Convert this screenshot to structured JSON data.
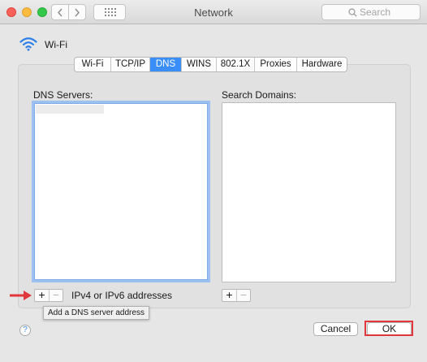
{
  "window": {
    "title": "Network",
    "search_placeholder": "Search"
  },
  "interface": {
    "name": "Wi-Fi"
  },
  "tabs": [
    {
      "label": "Wi-Fi"
    },
    {
      "label": "TCP/IP"
    },
    {
      "label": "DNS",
      "active": true
    },
    {
      "label": "WINS"
    },
    {
      "label": "802.1X"
    },
    {
      "label": "Proxies"
    },
    {
      "label": "Hardware"
    }
  ],
  "dns": {
    "servers_label": "DNS Servers:",
    "domains_label": "Search Domains:",
    "add_symbol": "+",
    "remove_symbol": "−",
    "hint": "IPv4 or IPv6 addresses",
    "tooltip": "Add a DNS server address"
  },
  "footer": {
    "help_symbol": "?",
    "cancel_label": "Cancel",
    "ok_label": "OK"
  },
  "colors": {
    "accent": "#3a8ef7",
    "annotation": "#e0363c"
  }
}
